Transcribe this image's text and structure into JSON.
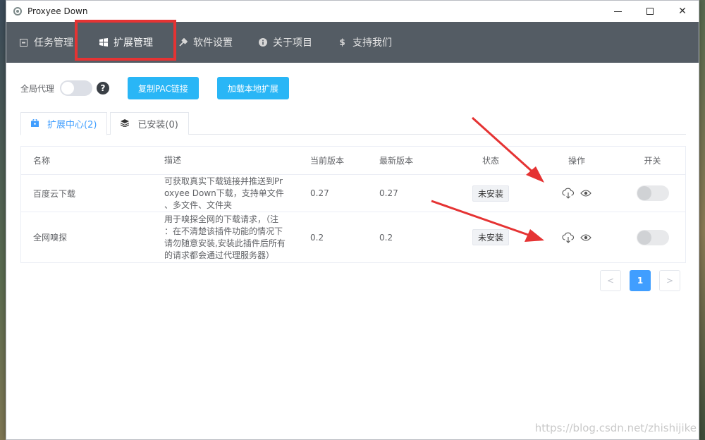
{
  "window": {
    "title": "Proxyee Down"
  },
  "nav": [
    {
      "label": "任务管理",
      "icon": "task-icon"
    },
    {
      "label": "扩展管理",
      "icon": "extension-icon",
      "active": true
    },
    {
      "label": "软件设置",
      "icon": "settings-icon"
    },
    {
      "label": "关于项目",
      "icon": "info-icon"
    },
    {
      "label": "支持我们",
      "icon": "dollar-icon"
    }
  ],
  "toolbar": {
    "global_proxy_label": "全局代理",
    "help_glyph": "?",
    "copy_pac_label": "复制PAC链接",
    "load_local_label": "加载本地扩展"
  },
  "tabs": [
    {
      "label": "扩展中心(2)",
      "active": true
    },
    {
      "label": "已安装(0)",
      "active": false
    }
  ],
  "table": {
    "headers": [
      "名称",
      "描述",
      "当前版本",
      "最新版本",
      "状态",
      "操作",
      "开关"
    ],
    "rows": [
      {
        "name": "百度云下载",
        "desc_lines": [
          "可获取真实下载链接并推送到Pr",
          "oxyee Down下载，支持单文件",
          "、多文件、文件夹"
        ],
        "current": "0.27",
        "latest": "0.27",
        "status": "未安装"
      },
      {
        "name": "全网嗅探",
        "desc_lines": [
          "用于嗅探全网的下载请求，（注",
          "：在不清楚该插件功能的情况下",
          "请勿随意安装,安装此插件后所有",
          "的请求都会通过代理服务器）"
        ],
        "current": "0.2",
        "latest": "0.2",
        "status": "未安装"
      }
    ]
  },
  "pagination": {
    "prev": "<",
    "current": "1",
    "next": ">"
  },
  "watermark": "https://blog.csdn.net/zhishijike",
  "colors": {
    "accent": "#409eff",
    "nav_bg": "#545c64",
    "button": "#29b6f6",
    "highlight": "#e53333",
    "arrow": "#e53333"
  }
}
